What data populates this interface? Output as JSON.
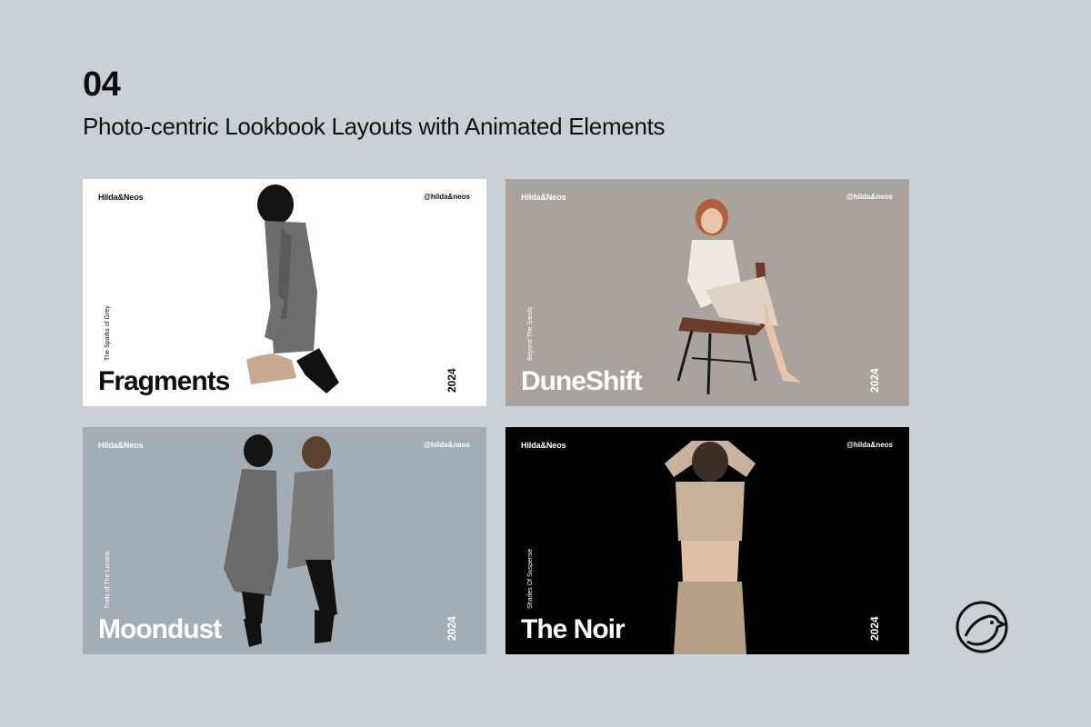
{
  "header": {
    "number": "04",
    "title": "Photo-centric Lookbook Layouts with Animated Elements"
  },
  "cards": [
    {
      "brand": "Hilda&Neos",
      "handle": "@hilda&neos",
      "subtitle": "The Sparks of Grey",
      "title": "Fragments",
      "year": "2024",
      "background": "#ffffff",
      "text_color": "#0d0d0d"
    },
    {
      "brand": "Hilda&Neos",
      "handle": "@hilda&neos",
      "subtitle": "Beyond The Sands",
      "title": "DuneShift",
      "year": "2024",
      "background": "#a9a29d",
      "text_color": "#ffffff"
    },
    {
      "brand": "Hilda&Neos",
      "handle": "@hilda&neos",
      "subtitle": "Trails of The Lunaris",
      "title": "Moondust",
      "year": "2024",
      "background": "#a3adb6",
      "text_color": "#ffffff"
    },
    {
      "brand": "Hilda&Neos",
      "handle": "@hilda&neos",
      "subtitle": "Shades Of Suspense",
      "title": "The Noir",
      "year": "2024",
      "background": "#000000",
      "text_color": "#ffffff"
    }
  ],
  "logo": {
    "icon": "bird-in-circle-icon"
  }
}
